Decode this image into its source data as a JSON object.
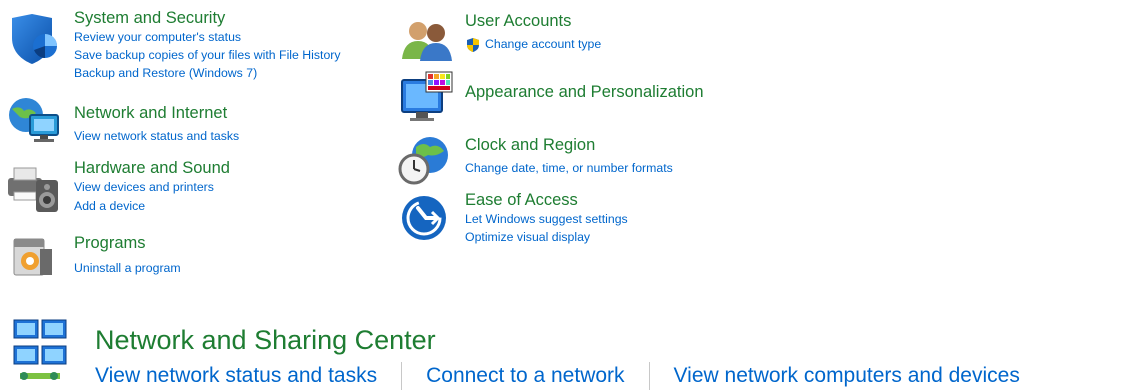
{
  "categories_left": [
    {
      "title": "System and Security",
      "icon": "shield-icon",
      "links": [
        "Review your computer's status",
        "Save backup copies of your files with File History",
        "Backup and Restore (Windows 7)"
      ]
    },
    {
      "title": "Network and Internet",
      "icon": "network-globe-icon",
      "links": [
        "View network status and tasks"
      ]
    },
    {
      "title": "Hardware and Sound",
      "icon": "printer-speaker-icon",
      "links": [
        "View devices and printers",
        "Add a device"
      ]
    },
    {
      "title": "Programs",
      "icon": "programs-icon",
      "links": [
        "Uninstall a program"
      ]
    }
  ],
  "categories_right": [
    {
      "title": "User Accounts",
      "icon": "users-icon",
      "links": [
        "Change account type"
      ]
    },
    {
      "title": "Appearance and Personalization",
      "icon": "monitor-palette-icon",
      "links": []
    },
    {
      "title": "Clock and Region",
      "icon": "clock-globe-icon",
      "links": [
        "Change date, time, or number formats"
      ]
    },
    {
      "title": "Ease of Access",
      "icon": "ease-of-access-icon",
      "links": [
        "Let Windows suggest settings",
        "Optimize visual display"
      ]
    }
  ],
  "network_sharing": {
    "title": "Network and Sharing Center",
    "icon": "network-computers-icon",
    "links": [
      "View network status and tasks",
      "Connect to a network",
      "View network computers and devices"
    ]
  },
  "colors": {
    "title_green": "#1e7d32",
    "link_blue": "#0066cc",
    "separator": "#c8c8c8"
  }
}
